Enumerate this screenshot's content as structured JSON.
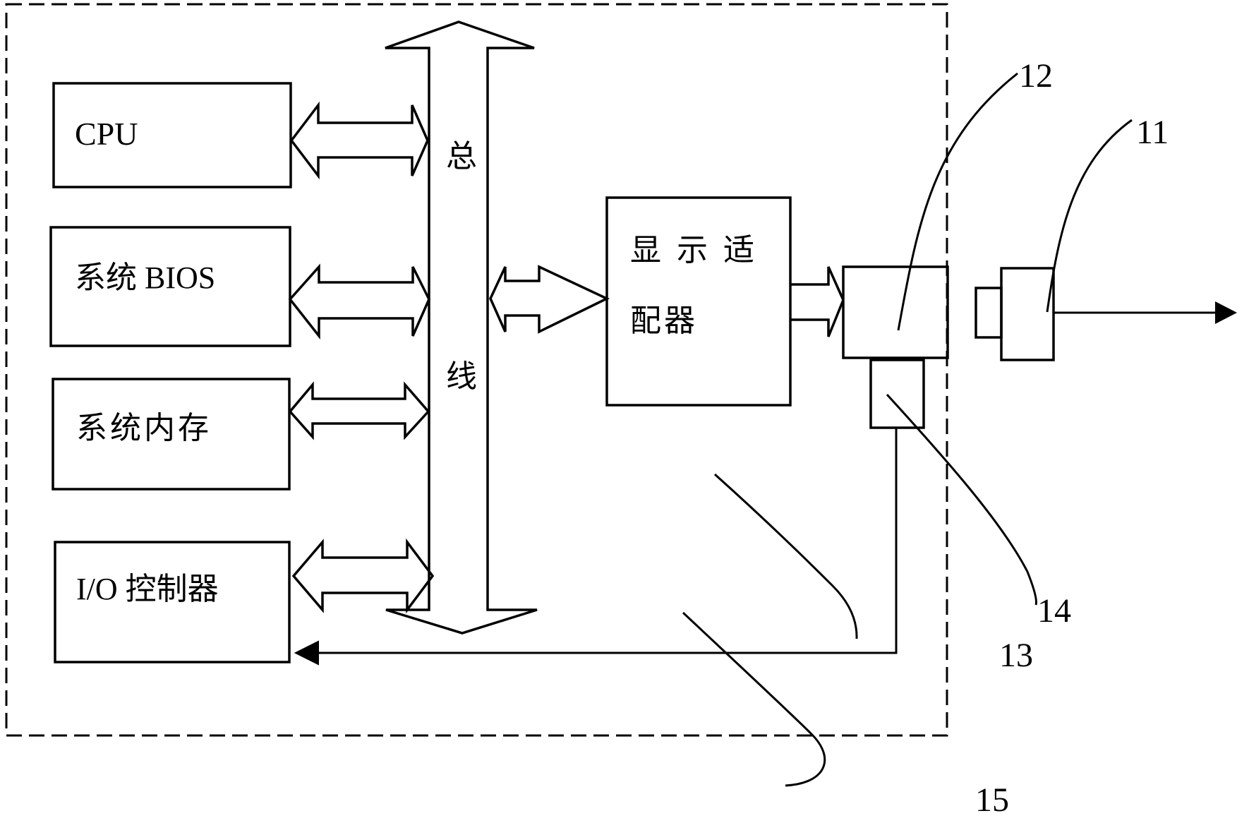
{
  "figure": {
    "blocks": {
      "cpu": "CPU",
      "bios": "系统 BIOS",
      "memory": "系统内存",
      "io_controller": "I/O 控制器",
      "display_adapter_line1": "显 示 适",
      "display_adapter_line2": "配器"
    },
    "bus": {
      "char1": "总",
      "char2": "线"
    },
    "reference_numerals": {
      "plug": "11",
      "socket": "12",
      "host_board": "13",
      "detector": "14",
      "signal_line": "15"
    }
  }
}
